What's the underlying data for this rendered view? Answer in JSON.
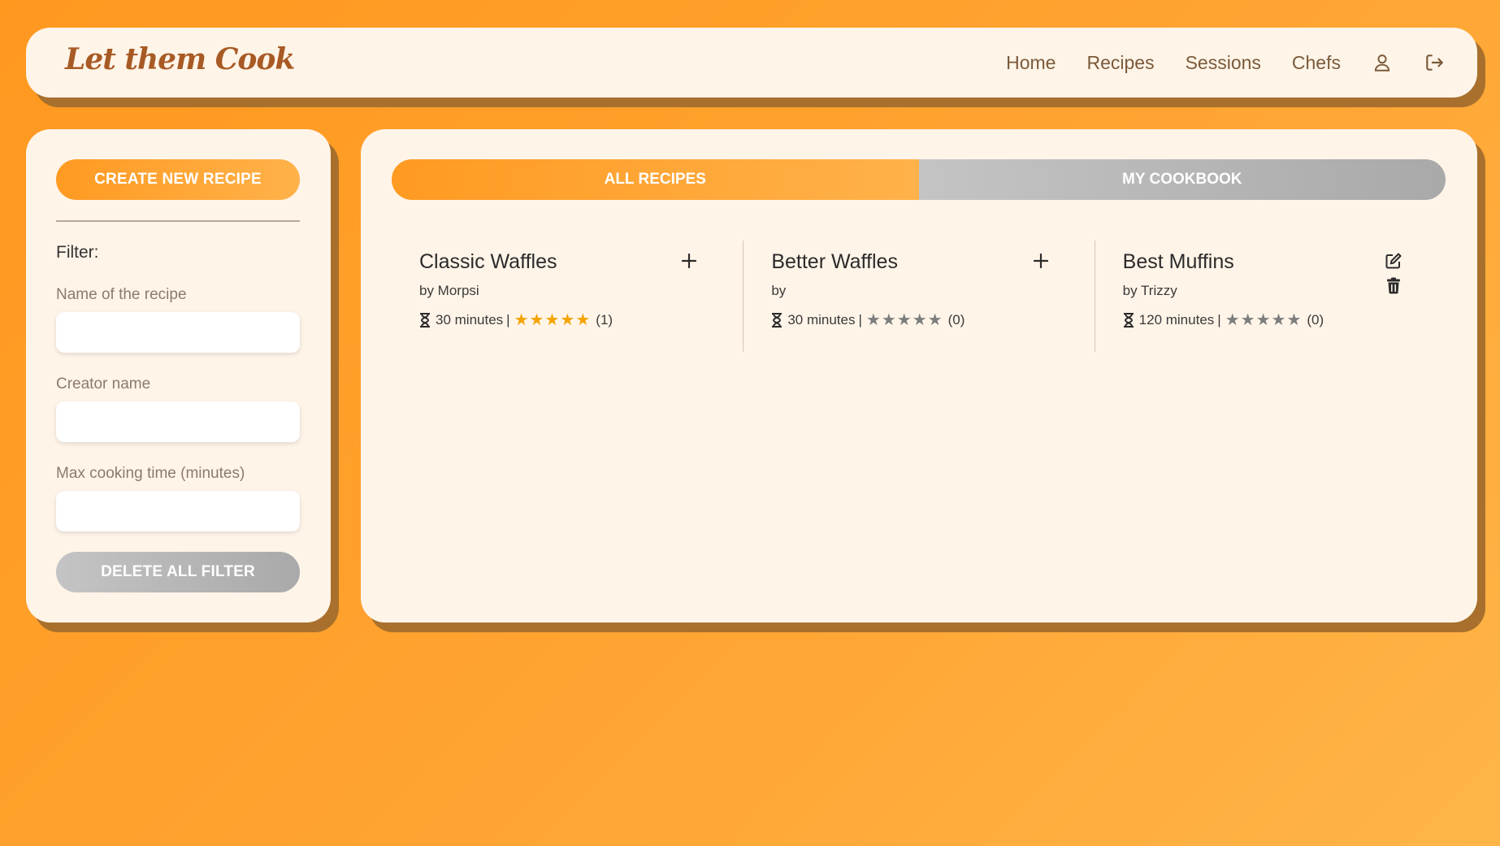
{
  "header": {
    "logo": "Let them Cook",
    "nav": [
      "Home",
      "Recipes",
      "Sessions",
      "Chefs"
    ],
    "icons": [
      "user-icon",
      "logout-icon"
    ]
  },
  "sidebar": {
    "create_button": "CREATE NEW RECIPE",
    "filter_title": "Filter:",
    "name_label": "Name of the recipe",
    "name_value": "",
    "creator_label": "Creator name",
    "creator_value": "",
    "time_label": "Max cooking time (minutes)",
    "time_value": "",
    "delete_button": "DELETE ALL FILTER"
  },
  "tabs": {
    "all": "ALL RECIPES",
    "cookbook": "MY COOKBOOK",
    "active": "all"
  },
  "recipes": [
    {
      "title": "Classic Waffles",
      "author": "by Morpsi",
      "time": "30 minutes",
      "sep": "|",
      "rating": 5,
      "count": "(1)",
      "actions": [
        "plus-icon"
      ]
    },
    {
      "title": "Better Waffles",
      "author": "by",
      "time": "30 minutes",
      "sep": "|",
      "rating": 0,
      "count": "(0)",
      "actions": [
        "plus-icon"
      ]
    },
    {
      "title": "Best Muffins",
      "author": "by Trizzy",
      "time": "120 minutes",
      "sep": "|",
      "rating": 0,
      "count": "(0)",
      "actions": [
        "edit-icon",
        "trash-icon"
      ]
    }
  ],
  "colors": {
    "accent": "#ff9a22",
    "card": "#fff4e8",
    "star_on": "#f5a300",
    "star_off": "#7d7d7d"
  }
}
